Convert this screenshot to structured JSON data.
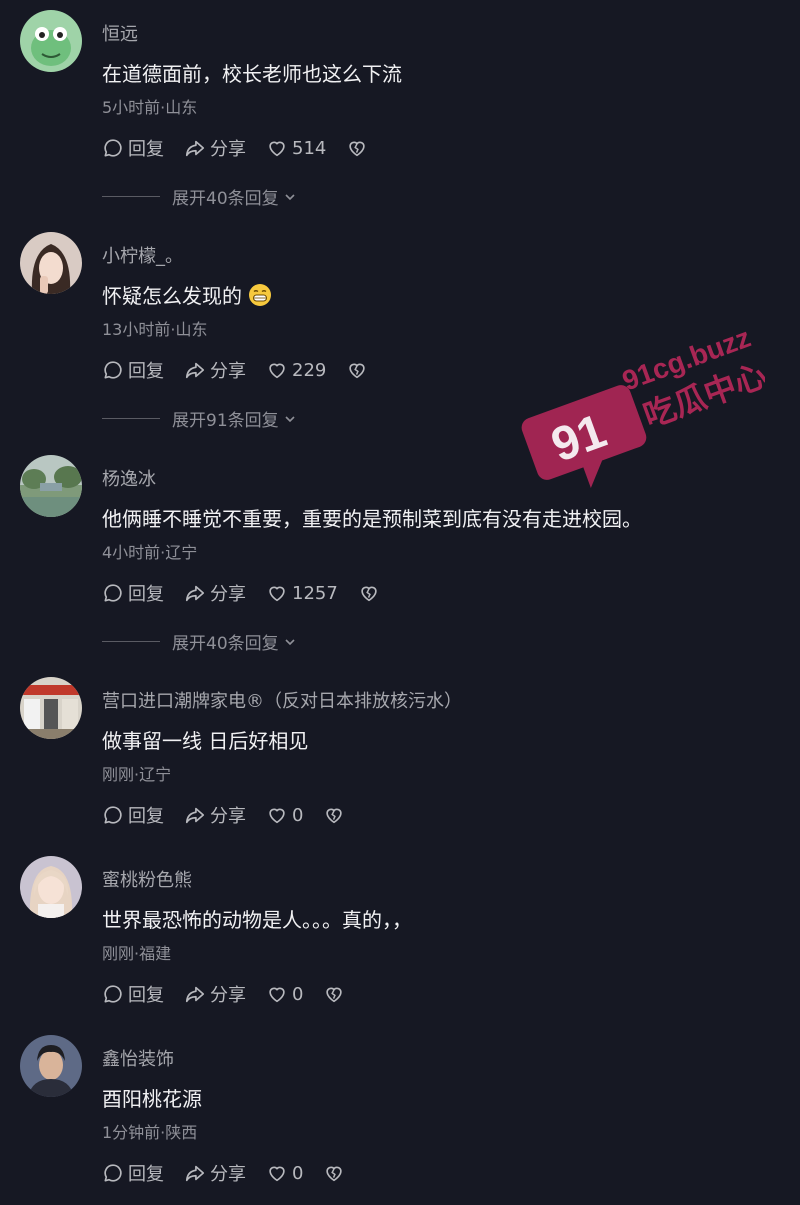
{
  "comments": [
    {
      "username": "恒远",
      "text": "在道德面前，校长老师也这么下流",
      "meta": "5小时前·山东",
      "reply_label": "回复",
      "share_label": "分享",
      "likes": "514",
      "expand": "展开40条回复",
      "avatar": "frog-avatar"
    },
    {
      "username": "小柠檬_。",
      "text": "怀疑怎么发现的",
      "meta": "13小时前·山东",
      "reply_label": "回复",
      "share_label": "分享",
      "likes": "229",
      "expand": "展开91条回复",
      "avatar": "woman-selfie-avatar"
    },
    {
      "username": "杨逸冰",
      "text": "他俩睡不睡觉不重要，重要的是预制菜到底有没有走进校园。",
      "meta": "4小时前·辽宁",
      "reply_label": "回复",
      "share_label": "分享",
      "likes": "1257",
      "expand": "展开40条回复",
      "avatar": "garden-avatar"
    },
    {
      "username": "营口进口潮牌家电®（反对日本排放核污水）",
      "text": "做事留一线 日后好相见",
      "meta": "刚刚·辽宁",
      "reply_label": "回复",
      "share_label": "分享",
      "likes": "0",
      "avatar": "store-avatar"
    },
    {
      "username": "蜜桃粉色熊",
      "text": "世界最恐怖的动物是人。。。真的，，",
      "meta": "刚刚·福建",
      "reply_label": "回复",
      "share_label": "分享",
      "likes": "0",
      "avatar": "girl-avatar"
    },
    {
      "username": "鑫怡装饰",
      "text": "酉阳桃花源",
      "meta": "1分钟前·陕西",
      "reply_label": "回复",
      "share_label": "分享",
      "likes": "0",
      "avatar": "man-avatar"
    }
  ],
  "watermark": {
    "number": "91",
    "site": "91cg.buzz",
    "brand": "吃瓜中心"
  }
}
